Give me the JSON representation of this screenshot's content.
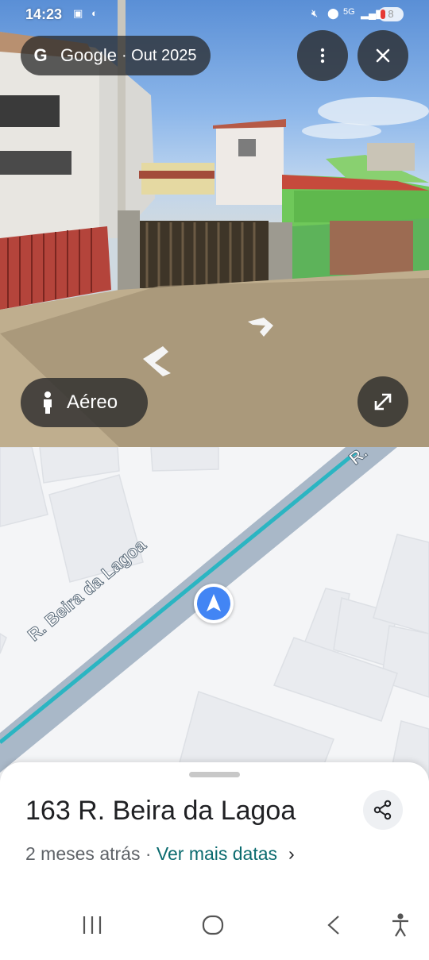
{
  "status_bar": {
    "time": "14:23",
    "battery_level": "8"
  },
  "streetview": {
    "brand": "Google",
    "date": "· Out 2025",
    "aerial_label": "Aéreo",
    "icons": {
      "menu": "more-vert-icon",
      "close": "close-icon",
      "expand": "expand-icon",
      "person": "person-icon"
    }
  },
  "map": {
    "street_label": "R. Beira da Lagoa",
    "street_label_top": "R.",
    "colors": {
      "road": "#a9b8c8",
      "route": "#2bb5c2",
      "position": "#4285f4"
    }
  },
  "place": {
    "address": "163 R. Beira da Lagoa",
    "time_ago": "2 meses atrás",
    "separator": " · ",
    "more_dates": "Ver mais datas"
  }
}
